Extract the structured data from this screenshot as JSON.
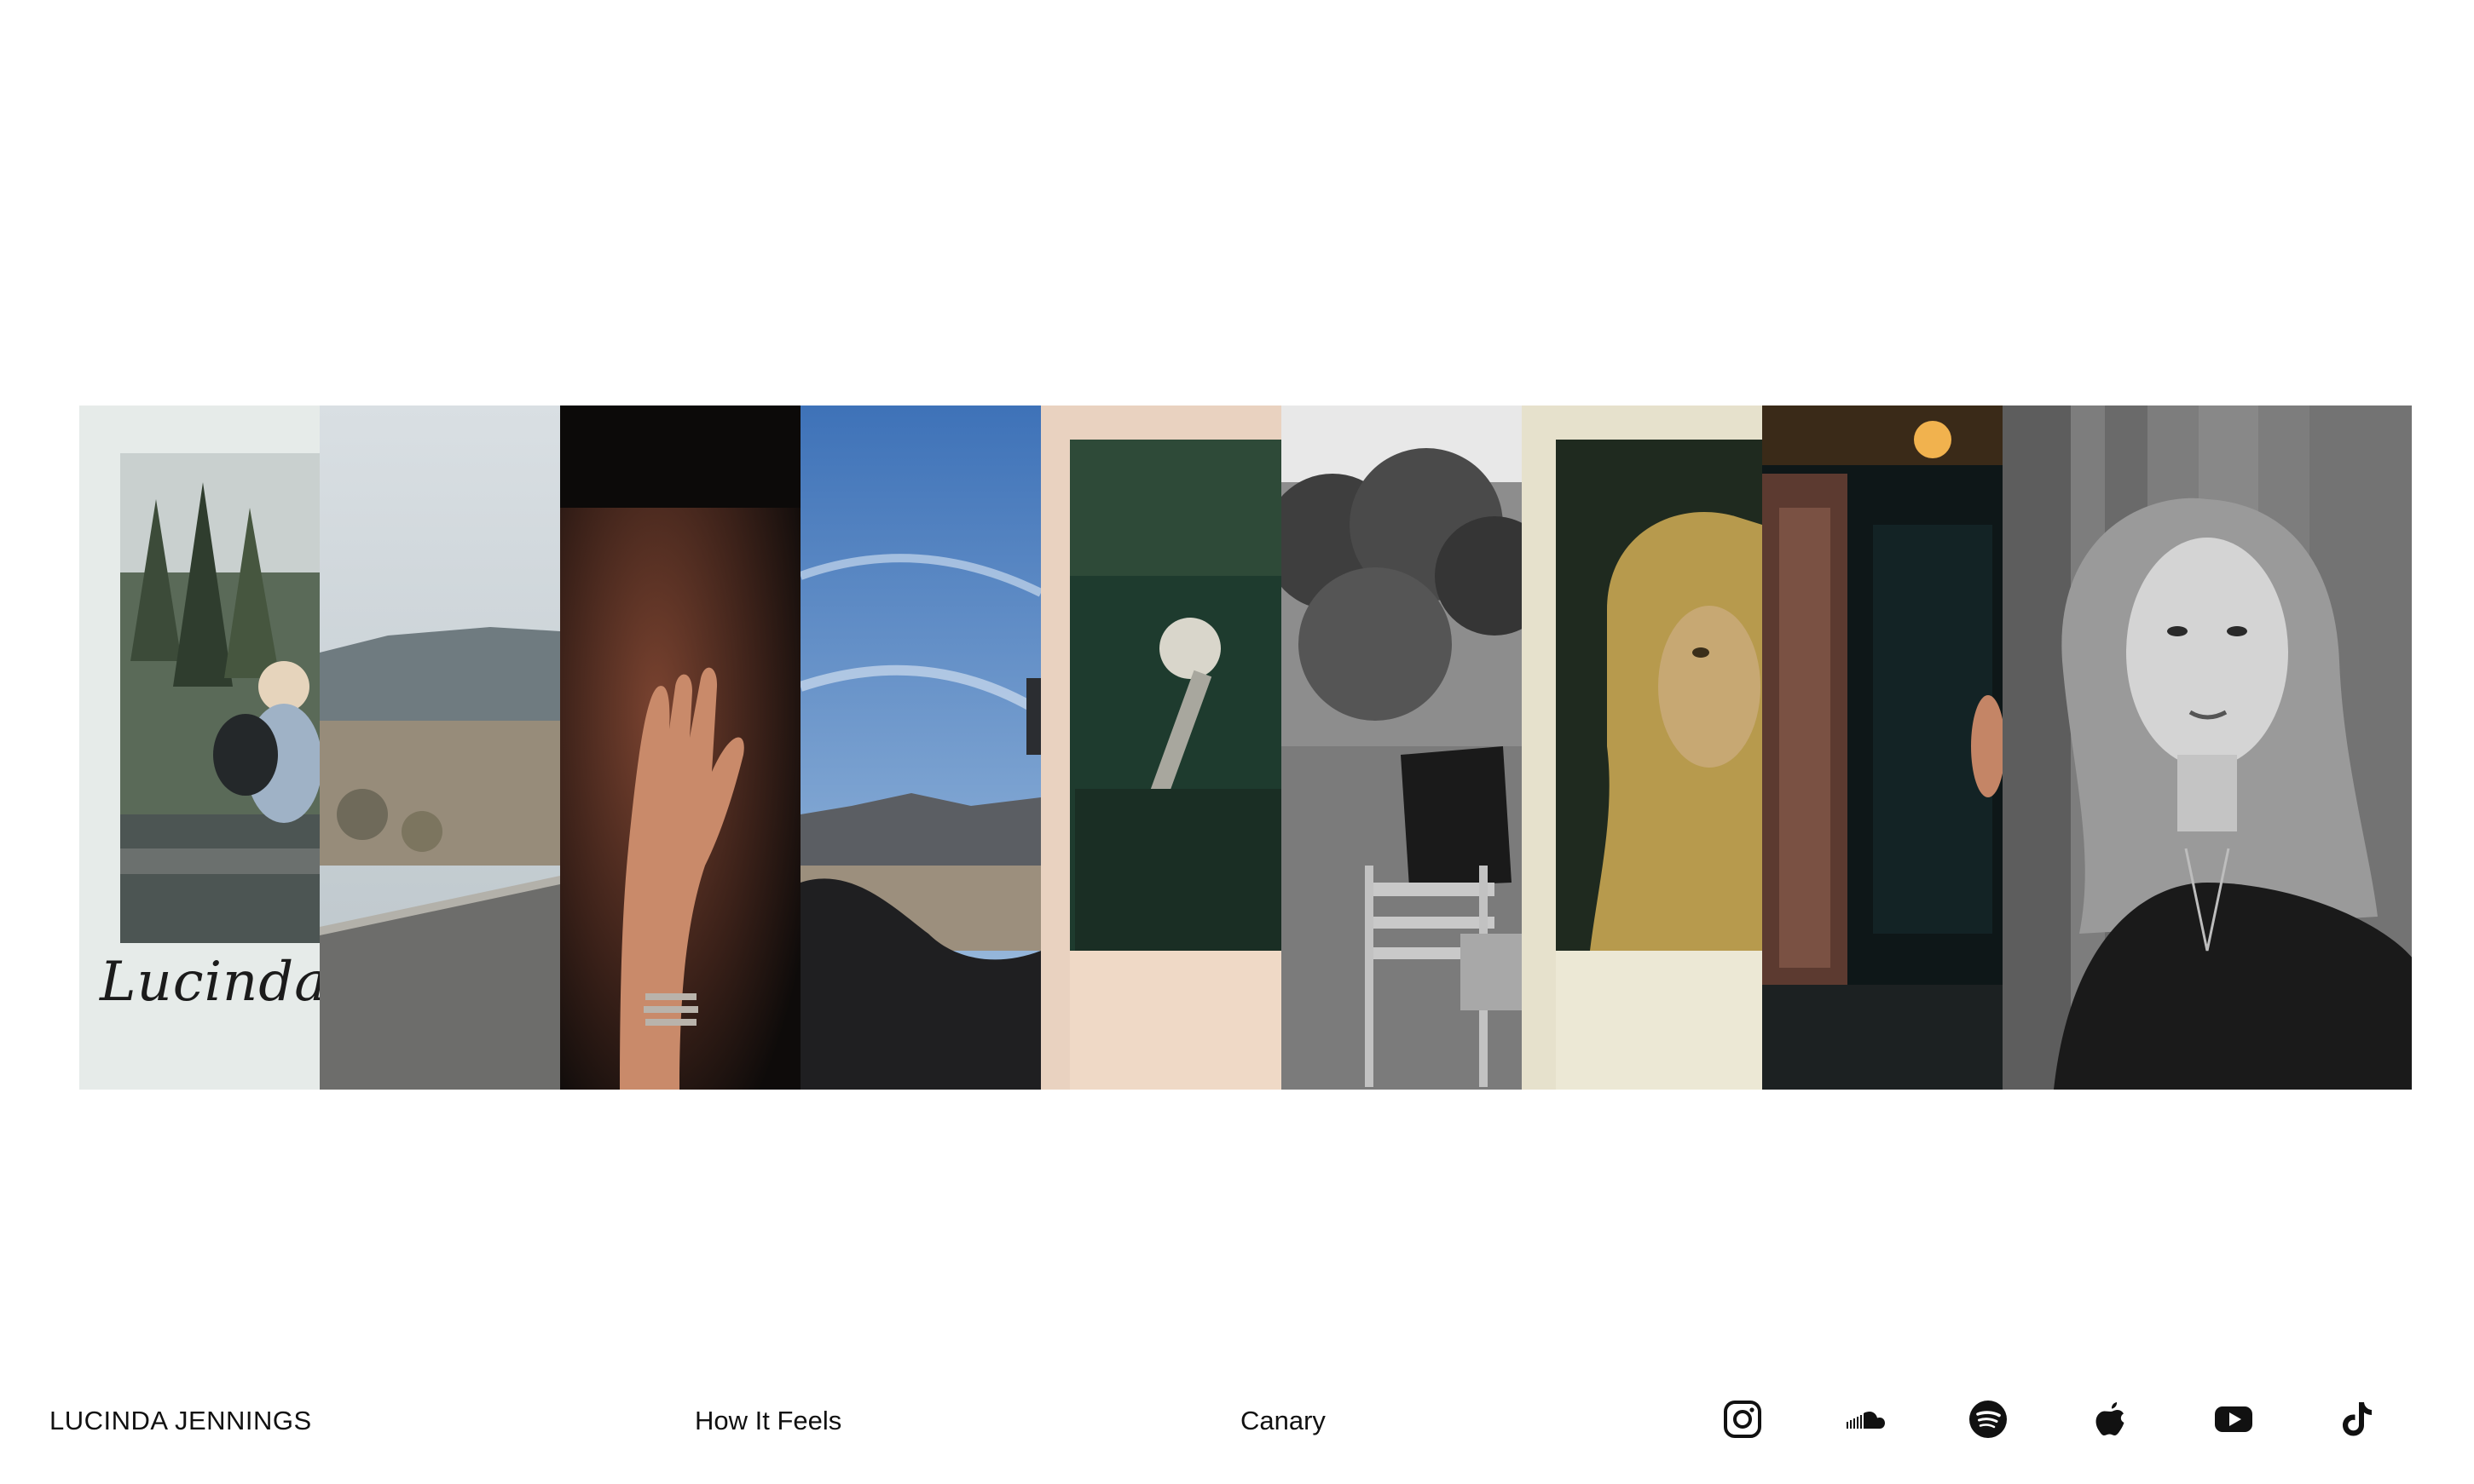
{
  "brand": "LUCINDA JENNINGS",
  "nav": {
    "song_1": "How It Feels",
    "song_2": "Canary"
  },
  "gallery": {
    "signature": "Lucinda",
    "photos": [
      "polaroid-trees",
      "road-hills",
      "hand-hair",
      "desert-sky",
      "polaroid-microphone",
      "bw-chair-bushes",
      "polaroid-portrait",
      "doorway-night",
      "bw-portrait"
    ]
  },
  "social": [
    {
      "name": "instagram-icon"
    },
    {
      "name": "soundcloud-icon"
    },
    {
      "name": "spotify-icon"
    },
    {
      "name": "apple-music-icon"
    },
    {
      "name": "youtube-icon"
    },
    {
      "name": "tiktok-icon"
    }
  ],
  "colors": {
    "text": "#111111",
    "background": "#ffffff"
  }
}
